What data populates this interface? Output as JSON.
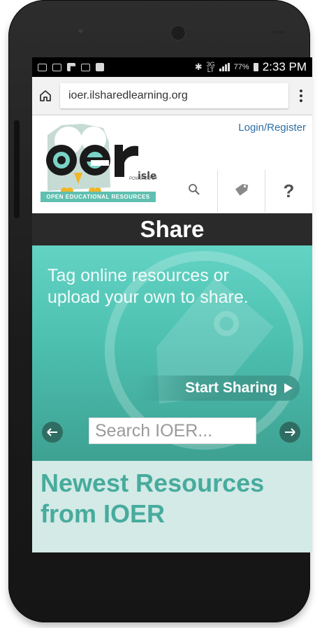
{
  "status_bar": {
    "network": "3G",
    "network_sub": "LT",
    "battery_percent": "77%",
    "time": "2:33 PM",
    "icons": [
      "screenshot-icon",
      "screenshot-icon",
      "flipboard-icon",
      "gmail-icon",
      "shopping-icon",
      "bluetooth-icon",
      "signal-icon",
      "battery-icon"
    ]
  },
  "browser": {
    "url": "ioer.ilsharedlearning.org",
    "home_icon": "home-icon",
    "menu_icon": "overflow-menu-icon"
  },
  "header": {
    "login_label": "Login/Register",
    "logo_text": "oer",
    "powered_by": "POWERED BY",
    "isle_text": "isle",
    "banner_text": "OPEN EDUCATIONAL RESOURCES",
    "tools": [
      {
        "icon": "search-icon"
      },
      {
        "icon": "tag-icon"
      },
      {
        "icon": "help-icon",
        "label": "?"
      }
    ]
  },
  "share": {
    "title": "Share",
    "hero_text": "Tag online resources or upload your own to share.",
    "start_label": "Start Sharing",
    "search_placeholder": "Search IOER..."
  },
  "newest": {
    "title": "Newest Resources from IOER"
  },
  "colors": {
    "teal": "#4dc0b0",
    "dark_teal": "#2f6d63",
    "title_bar": "#2a2a2a",
    "newest_text": "#47ab9d",
    "link": "#2d6fa5"
  }
}
